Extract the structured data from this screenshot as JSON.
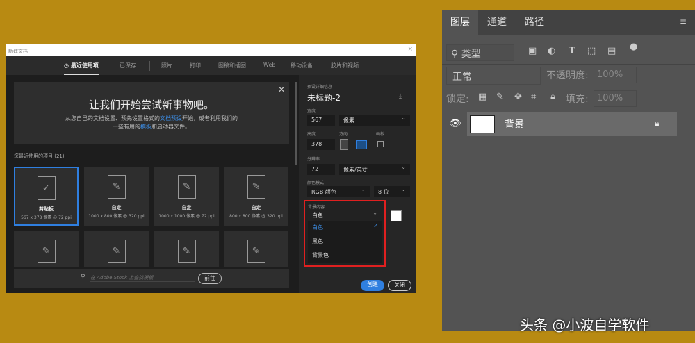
{
  "dialog": {
    "title": "新建文档",
    "tabs": [
      "最近使用项",
      "已保存",
      "照片",
      "打印",
      "图稿和插图",
      "Web",
      "移动设备",
      "胶片和视频"
    ],
    "hero": {
      "title": "让我们开始尝试新事物吧。",
      "line1_a": "从您自己的文档设置、预先设置格式的",
      "line1_link": "文档预设",
      "line1_b": "开始，或者利用我们的",
      "line2_a": "一些有用的",
      "line2_link": "模板",
      "line2_b": "和启动器文件。"
    },
    "recent_label": "您最近使用的项目",
    "recent_count": "(21)",
    "cards": [
      {
        "name": "剪贴板",
        "desc": "567 x 378 像素 @ 72 ppi"
      },
      {
        "name": "自定",
        "desc": "1000 x 800 像素 @ 320 ppi"
      },
      {
        "name": "自定",
        "desc": "1000 x 1000 像素 @ 72 ppi"
      },
      {
        "name": "自定",
        "desc": "800 x 800 像素 @ 320 ppi"
      }
    ],
    "search_placeholder": "在 Adobe Stock 上查找模板",
    "go_label": "前往",
    "preset": {
      "section": "预设详细信息",
      "name": "未标题-2",
      "width_label": "宽度",
      "width": "567",
      "width_unit": "像素",
      "height_label": "高度",
      "height": "378",
      "orientation_label": "方向",
      "artboard_label": "画板",
      "resolution_label": "分辨率",
      "resolution": "72",
      "resolution_unit": "像素/英寸",
      "color_mode_label": "颜色模式",
      "color_mode": "RGB 颜色",
      "bit_depth": "8 位",
      "bg_label": "背景内容",
      "bg_value": "白色",
      "bg_options": [
        "白色",
        "黑色",
        "背景色"
      ]
    },
    "create_label": "创建",
    "close_label": "关闭"
  },
  "layers": {
    "tabs": [
      "图层",
      "通道",
      "路径"
    ],
    "filter": "类型",
    "blend": "正常",
    "opacity_label": "不透明度:",
    "opacity": "100%",
    "lock_label": "锁定:",
    "fill_label": "填充:",
    "fill": "100%",
    "layer_name": "背景"
  },
  "watermark": "头条 @小波自学软件",
  "colors": {
    "accent": "#2f7fe0",
    "background": "#b88a12",
    "highlight": "#e02020"
  }
}
